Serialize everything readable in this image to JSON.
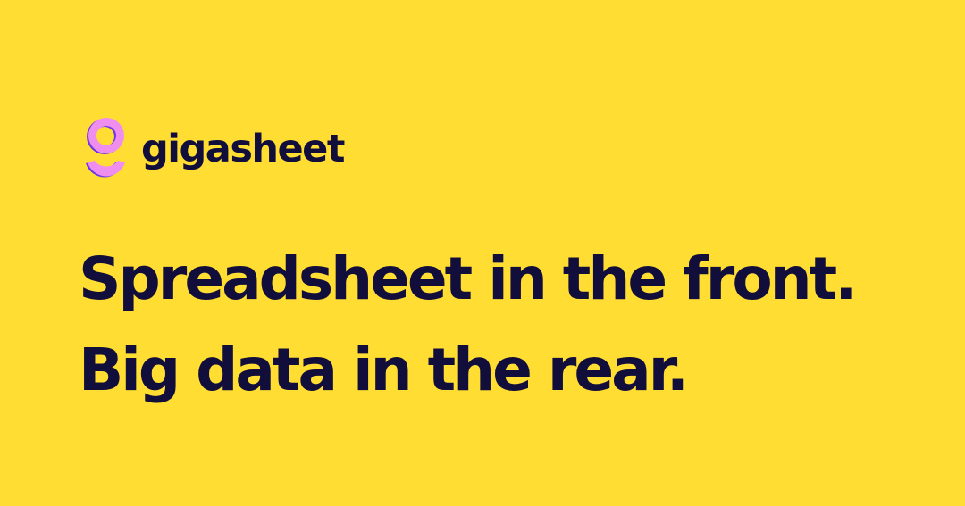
{
  "brand": {
    "name": "gigasheet",
    "logo_icon": "gigasheet-logo-icon",
    "logo_colors": {
      "fill": "#F08EF0",
      "outline": "#6B38E6"
    }
  },
  "headline": {
    "line1": "Spreadsheet in the front.",
    "line2": "Big data in the rear."
  },
  "colors": {
    "background": "#FFDD33",
    "text": "#110E3B"
  }
}
